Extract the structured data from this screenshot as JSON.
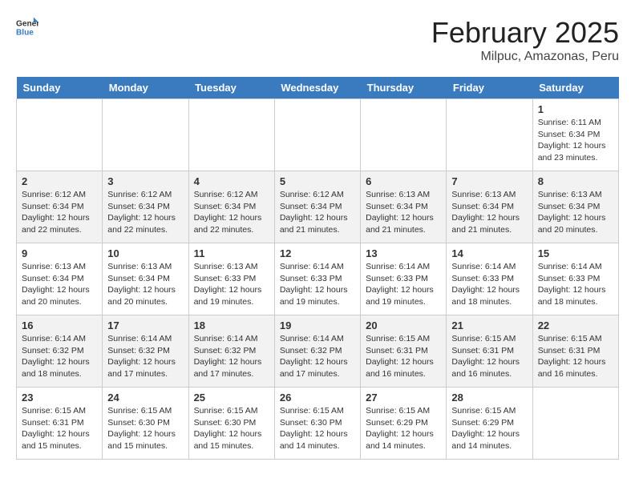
{
  "header": {
    "logo_general": "General",
    "logo_blue": "Blue",
    "title": "February 2025",
    "subtitle": "Milpuc, Amazonas, Peru"
  },
  "days_of_week": [
    "Sunday",
    "Monday",
    "Tuesday",
    "Wednesday",
    "Thursday",
    "Friday",
    "Saturday"
  ],
  "weeks": [
    {
      "cells": [
        {
          "day": "",
          "empty": true
        },
        {
          "day": "",
          "empty": true
        },
        {
          "day": "",
          "empty": true
        },
        {
          "day": "",
          "empty": true
        },
        {
          "day": "",
          "empty": true
        },
        {
          "day": "",
          "empty": true
        },
        {
          "day": "1",
          "text": "Sunrise: 6:11 AM\nSunset: 6:34 PM\nDaylight: 12 hours\nand 23 minutes."
        }
      ]
    },
    {
      "cells": [
        {
          "day": "2",
          "text": "Sunrise: 6:12 AM\nSunset: 6:34 PM\nDaylight: 12 hours\nand 22 minutes."
        },
        {
          "day": "3",
          "text": "Sunrise: 6:12 AM\nSunset: 6:34 PM\nDaylight: 12 hours\nand 22 minutes."
        },
        {
          "day": "4",
          "text": "Sunrise: 6:12 AM\nSunset: 6:34 PM\nDaylight: 12 hours\nand 22 minutes."
        },
        {
          "day": "5",
          "text": "Sunrise: 6:12 AM\nSunset: 6:34 PM\nDaylight: 12 hours\nand 21 minutes."
        },
        {
          "day": "6",
          "text": "Sunrise: 6:13 AM\nSunset: 6:34 PM\nDaylight: 12 hours\nand 21 minutes."
        },
        {
          "day": "7",
          "text": "Sunrise: 6:13 AM\nSunset: 6:34 PM\nDaylight: 12 hours\nand 21 minutes."
        },
        {
          "day": "8",
          "text": "Sunrise: 6:13 AM\nSunset: 6:34 PM\nDaylight: 12 hours\nand 20 minutes."
        }
      ]
    },
    {
      "cells": [
        {
          "day": "9",
          "text": "Sunrise: 6:13 AM\nSunset: 6:34 PM\nDaylight: 12 hours\nand 20 minutes."
        },
        {
          "day": "10",
          "text": "Sunrise: 6:13 AM\nSunset: 6:34 PM\nDaylight: 12 hours\nand 20 minutes."
        },
        {
          "day": "11",
          "text": "Sunrise: 6:13 AM\nSunset: 6:33 PM\nDaylight: 12 hours\nand 19 minutes."
        },
        {
          "day": "12",
          "text": "Sunrise: 6:14 AM\nSunset: 6:33 PM\nDaylight: 12 hours\nand 19 minutes."
        },
        {
          "day": "13",
          "text": "Sunrise: 6:14 AM\nSunset: 6:33 PM\nDaylight: 12 hours\nand 19 minutes."
        },
        {
          "day": "14",
          "text": "Sunrise: 6:14 AM\nSunset: 6:33 PM\nDaylight: 12 hours\nand 18 minutes."
        },
        {
          "day": "15",
          "text": "Sunrise: 6:14 AM\nSunset: 6:33 PM\nDaylight: 12 hours\nand 18 minutes."
        }
      ]
    },
    {
      "cells": [
        {
          "day": "16",
          "text": "Sunrise: 6:14 AM\nSunset: 6:32 PM\nDaylight: 12 hours\nand 18 minutes."
        },
        {
          "day": "17",
          "text": "Sunrise: 6:14 AM\nSunset: 6:32 PM\nDaylight: 12 hours\nand 17 minutes."
        },
        {
          "day": "18",
          "text": "Sunrise: 6:14 AM\nSunset: 6:32 PM\nDaylight: 12 hours\nand 17 minutes."
        },
        {
          "day": "19",
          "text": "Sunrise: 6:14 AM\nSunset: 6:32 PM\nDaylight: 12 hours\nand 17 minutes."
        },
        {
          "day": "20",
          "text": "Sunrise: 6:15 AM\nSunset: 6:31 PM\nDaylight: 12 hours\nand 16 minutes."
        },
        {
          "day": "21",
          "text": "Sunrise: 6:15 AM\nSunset: 6:31 PM\nDaylight: 12 hours\nand 16 minutes."
        },
        {
          "day": "22",
          "text": "Sunrise: 6:15 AM\nSunset: 6:31 PM\nDaylight: 12 hours\nand 16 minutes."
        }
      ]
    },
    {
      "cells": [
        {
          "day": "23",
          "text": "Sunrise: 6:15 AM\nSunset: 6:31 PM\nDaylight: 12 hours\nand 15 minutes."
        },
        {
          "day": "24",
          "text": "Sunrise: 6:15 AM\nSunset: 6:30 PM\nDaylight: 12 hours\nand 15 minutes."
        },
        {
          "day": "25",
          "text": "Sunrise: 6:15 AM\nSunset: 6:30 PM\nDaylight: 12 hours\nand 15 minutes."
        },
        {
          "day": "26",
          "text": "Sunrise: 6:15 AM\nSunset: 6:30 PM\nDaylight: 12 hours\nand 14 minutes."
        },
        {
          "day": "27",
          "text": "Sunrise: 6:15 AM\nSunset: 6:29 PM\nDaylight: 12 hours\nand 14 minutes."
        },
        {
          "day": "28",
          "text": "Sunrise: 6:15 AM\nSunset: 6:29 PM\nDaylight: 12 hours\nand 14 minutes."
        },
        {
          "day": "",
          "empty": true
        }
      ]
    }
  ]
}
